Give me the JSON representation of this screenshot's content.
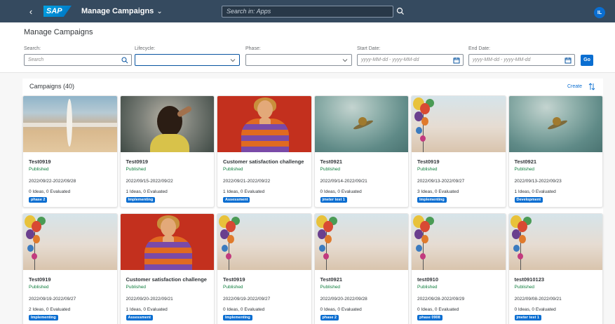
{
  "shellbar": {
    "app_title": "Manage Campaigns",
    "search_placeholder": "Search in: Apps",
    "avatar_initials": "IL"
  },
  "page": {
    "title": "Manage Campaigns"
  },
  "filters": {
    "search": {
      "label": "Search:",
      "placeholder": "Search",
      "value": ""
    },
    "lifecycle": {
      "label": "Lifecycle:",
      "value": ""
    },
    "phase": {
      "label": "Phase:",
      "value": ""
    },
    "start_date": {
      "label": "Start Date:",
      "placeholder": "yyyy-MM-dd - yyyy-MM-dd"
    },
    "end_date": {
      "label": "End Date:",
      "placeholder": "yyyy-MM-dd - yyyy-MM-dd"
    },
    "go_label": "Go"
  },
  "campaigns": {
    "title": "Campaigns (40)",
    "create_label": "Create",
    "items": [
      {
        "title": "Test0919",
        "status": "Published",
        "dates": "2022/09/22-2022/09/28",
        "ideas": "0 Ideas, 0 Evaluated",
        "phase": "phase 2",
        "image": "beach"
      },
      {
        "title": "Test0919",
        "status": "Published",
        "dates": "2022/09/15-2022/09/22",
        "ideas": "1 Ideas, 0 Evaluated",
        "phase": "Implementing",
        "image": "woman"
      },
      {
        "title": "Customer satisfaction challenge",
        "status": "Published",
        "dates": "2022/09/21-2022/09/22",
        "ideas": "1 Ideas, 0 Evaluated",
        "phase": "Assessment",
        "image": "heart"
      },
      {
        "title": "Test0921",
        "status": "Published",
        "dates": "2022/09/14-2022/09/21",
        "ideas": "0 Ideas, 0 Evaluated",
        "phase": "jmeter test 1",
        "image": "lake"
      },
      {
        "title": "Test0919",
        "status": "Published",
        "dates": "2022/09/13-2022/09/27",
        "ideas": "3 Ideas, 0 Evaluated",
        "phase": "Implementing",
        "image": "balloons"
      },
      {
        "title": "Test0921",
        "status": "Published",
        "dates": "2022/09/13-2022/09/23",
        "ideas": "1 Ideas, 0 Evaluated",
        "phase": "Development",
        "image": "lake"
      },
      {
        "title": "Test0919",
        "status": "Published",
        "dates": "2022/09/19-2022/09/27",
        "ideas": "2 Ideas, 0 Evaluated",
        "phase": "Implementing",
        "image": "balloons"
      },
      {
        "title": "Customer satisfaction challenge",
        "status": "Published",
        "dates": "2022/09/20-2022/09/21",
        "ideas": "1 Ideas, 0 Evaluated",
        "phase": "Assessment",
        "image": "heart"
      },
      {
        "title": "Test0919",
        "status": "Published",
        "dates": "2022/09/19-2022/09/27",
        "ideas": "0 Ideas, 0 Evaluated",
        "phase": "Implementing",
        "image": "balloons"
      },
      {
        "title": "Test0921",
        "status": "Published",
        "dates": "2022/09/20-2022/09/28",
        "ideas": "0 Ideas, 0 Evaluated",
        "phase": "phase 2",
        "image": "balloons"
      },
      {
        "title": "test0910",
        "status": "Published",
        "dates": "2022/09/28-2022/09/29",
        "ideas": "0 Ideas, 0 Evaluated",
        "phase": "phase 0908",
        "image": "balloons"
      },
      {
        "title": "test0910123",
        "status": "Published",
        "dates": "2022/09/08-2022/09/21",
        "ideas": "0 Ideas, 0 Evaluated",
        "phase": "jmeter test 1",
        "image": "balloons"
      }
    ]
  },
  "colors": {
    "shellbar": "#354a5f",
    "accent": "#0a6ed1",
    "status_positive": "#107e3e"
  },
  "icons": {
    "back": "back-icon",
    "search": "search-icon",
    "dropdown": "chevron-down-icon",
    "calendar": "calendar-icon",
    "sort": "sort-icon"
  }
}
